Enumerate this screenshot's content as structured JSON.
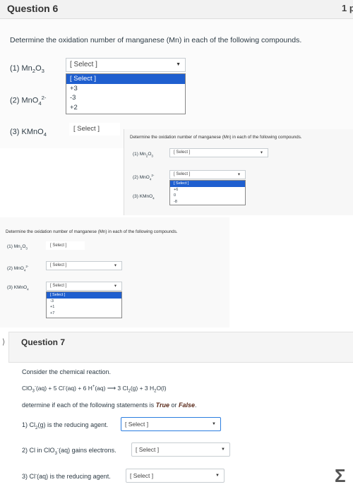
{
  "q6": {
    "title": "Question 6",
    "points": "1 p",
    "prompt": "Determine the oxidation number of manganese (Mn) in each of the following compounds.",
    "c1": "(1) Mn",
    "c1_sub1": "2",
    "c1_rest": "O",
    "c1_sub2": "3",
    "c2": "(2) MnO",
    "c2_sub": "4",
    "c2_sup": "2-",
    "c3": "(3) KMnO",
    "c3_sub": "4",
    "select_placeholder": "[ Select ]",
    "dropdown1": [
      "[ Select ]",
      "+3",
      "-3",
      "+2"
    ]
  },
  "inset1": {
    "prompt": "Determine the oxidation number of manganese (Mn) in each of the following compounds.",
    "select_placeholder": "[ Select ]",
    "dropdown": [
      "[ Select ]",
      "+6",
      "0",
      "-8"
    ]
  },
  "inset2": {
    "prompt": "Determine the oxidation number of manganese (Mn) in each of the following compounds.",
    "select_placeholder": "[ Select ]",
    "dropdown": [
      "[ Select ]",
      "-3",
      "+1",
      "+7"
    ]
  },
  "q7": {
    "title": "Question 7",
    "intro": "Consider the chemical reaction.",
    "eq_a": "ClO",
    "eq_a_sub": "3",
    "eq_a_sup": "-",
    "eq_b": "(aq) + 5 Cl",
    "eq_b_sup": "-",
    "eq_c": "(aq) + 6 H",
    "eq_c_sup": "+",
    "eq_d": "(aq) ",
    "eq_arrow": "⟶",
    "eq_e": " 3 Cl",
    "eq_e_sub": "2",
    "eq_f": "(g) + 3 H",
    "eq_f_sub": "2",
    "eq_g": "O(l)",
    "task_a": "determine if each of the following statements is ",
    "task_true": "True",
    "task_or": " or ",
    "task_false": "False",
    "task_end": ".",
    "s1_a": "1) Cl",
    "s1_sub": "2",
    "s1_b": "(g) is the reducing agent.",
    "s2_a": "2) Cl in ClO",
    "s2_sub": "3",
    "s2_sup": "-",
    "s2_b": "(aq) gains electrons.",
    "s3_a": "3) Cl",
    "s3_sup": "-",
    "s3_b": "(aq) is the reducing agent.",
    "select_placeholder": "[ Select ]"
  },
  "icons": {
    "dropdown_arrow": "▼",
    "collapse_marker": "⟩",
    "corner_logo": "Σ"
  },
  "colors": {
    "highlight": "#1f5fcf",
    "header_bg": "#f5f5f5",
    "bold_term": "#5a2a1a"
  }
}
